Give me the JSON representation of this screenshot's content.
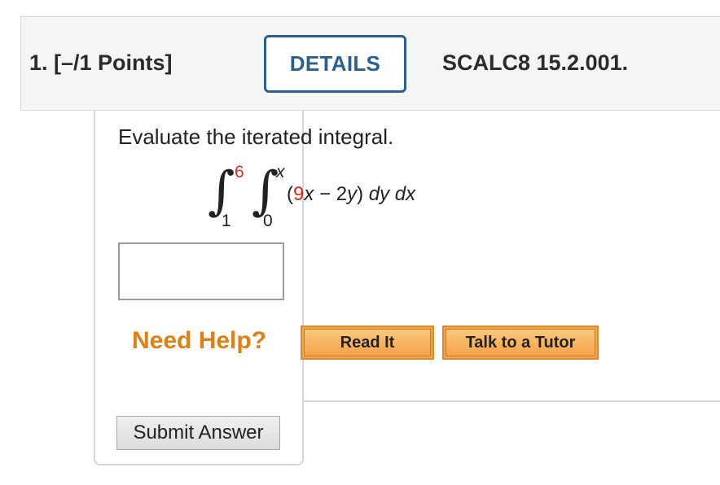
{
  "question": {
    "number_points": "1. [–/1 Points]",
    "details_label": "DETAILS",
    "code": "SCALC8 15.2.001."
  },
  "problem": {
    "prompt": "Evaluate the iterated integral.",
    "outer_lower": "1",
    "outer_upper": "6",
    "inner_lower": "0",
    "inner_upper": "x",
    "integrand_open": "(",
    "integrand_coef": "9",
    "integrand_x": "x",
    "integrand_rest": " − 2",
    "integrand_y": "y",
    "integrand_close": ") ",
    "dy": "dy",
    "space": " ",
    "dx": "dx"
  },
  "answer": {
    "value": ""
  },
  "help": {
    "need_help": "Need Help?",
    "read_it": "Read It",
    "talk_tutor": "Talk to a Tutor"
  },
  "submit": {
    "label": "Submit Answer"
  },
  "colors": {
    "details_border": "#2a5f8f",
    "need_help": "#e07f12",
    "help_button": "#f4a64a",
    "red_value": "#d42a1f"
  }
}
